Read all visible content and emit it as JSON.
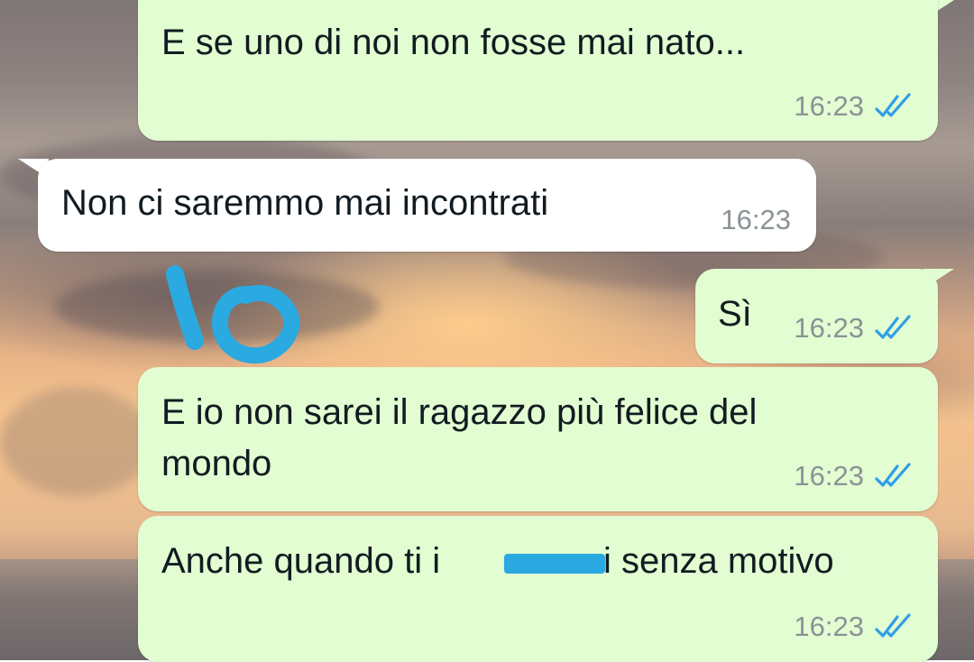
{
  "colors": {
    "outgoing_bubble": "#e2fdd1",
    "incoming_bubble": "#ffffff",
    "read_ticks": "#2e9ee8",
    "annotation_ink": "#2ba9e1"
  },
  "messages": [
    {
      "direction": "outgoing",
      "text": "E se uno di noi non fosse mai nato...",
      "time": "16:23",
      "status": "read"
    },
    {
      "direction": "incoming",
      "text": "Non ci saremmo mai incontrati",
      "time": "16:23"
    },
    {
      "direction": "outgoing",
      "text": "Sì",
      "time": "16:23",
      "status": "read"
    },
    {
      "direction": "outgoing",
      "text_line1": "E io non sarei il ragazzo più felice del",
      "text_line2": "mondo",
      "time": "16:23",
      "status": "read"
    },
    {
      "direction": "outgoing",
      "text_before": "Anche quando ti i",
      "text_after": "i senza motivo",
      "time": "16:23",
      "status": "read"
    }
  ],
  "annotation": {
    "text": "io",
    "icon": "handwritten-io-scribble"
  },
  "redaction": {
    "icon": "blue-redaction-mark"
  }
}
